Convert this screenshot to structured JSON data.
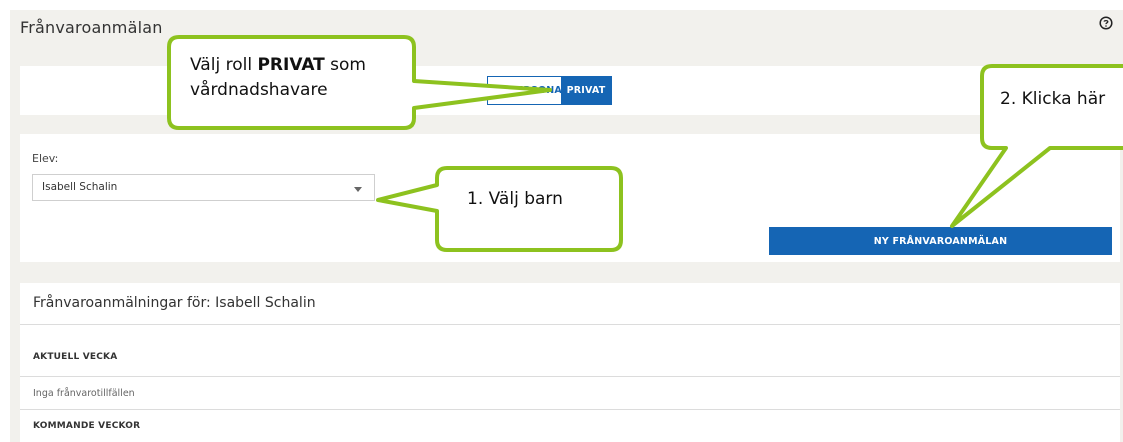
{
  "header": {
    "title": "Frånvaroanmälan"
  },
  "role": {
    "options": [
      "SKOLPERSONAL",
      "PRIVAT"
    ],
    "selected": "PRIVAT"
  },
  "student": {
    "label": "Elev:",
    "selected": "Isabell Schalin"
  },
  "actions": {
    "new_button": "NY FRÅNVAROANMÄLAN"
  },
  "list": {
    "heading": "Frånvaroanmälningar för: Isabell Schalin",
    "sections": [
      {
        "title": "AKTUELL VECKA",
        "empty_text": "Inga frånvarotillfällen"
      },
      {
        "title": "KOMMANDE VECKOR"
      }
    ]
  },
  "callouts": {
    "role": {
      "prefix": "Välj roll ",
      "bold": "PRIVAT",
      "suffix": " som",
      "line2": "vårdnadshavare"
    },
    "child": "1.  Välj barn",
    "click": "2. Klicka här"
  },
  "colors": {
    "primary": "#1565b4",
    "callout_border": "#8dc21f",
    "background": "#f2f1ed"
  },
  "icons": {
    "help": "question-circle-icon",
    "dropdown": "chevron-down-icon"
  }
}
